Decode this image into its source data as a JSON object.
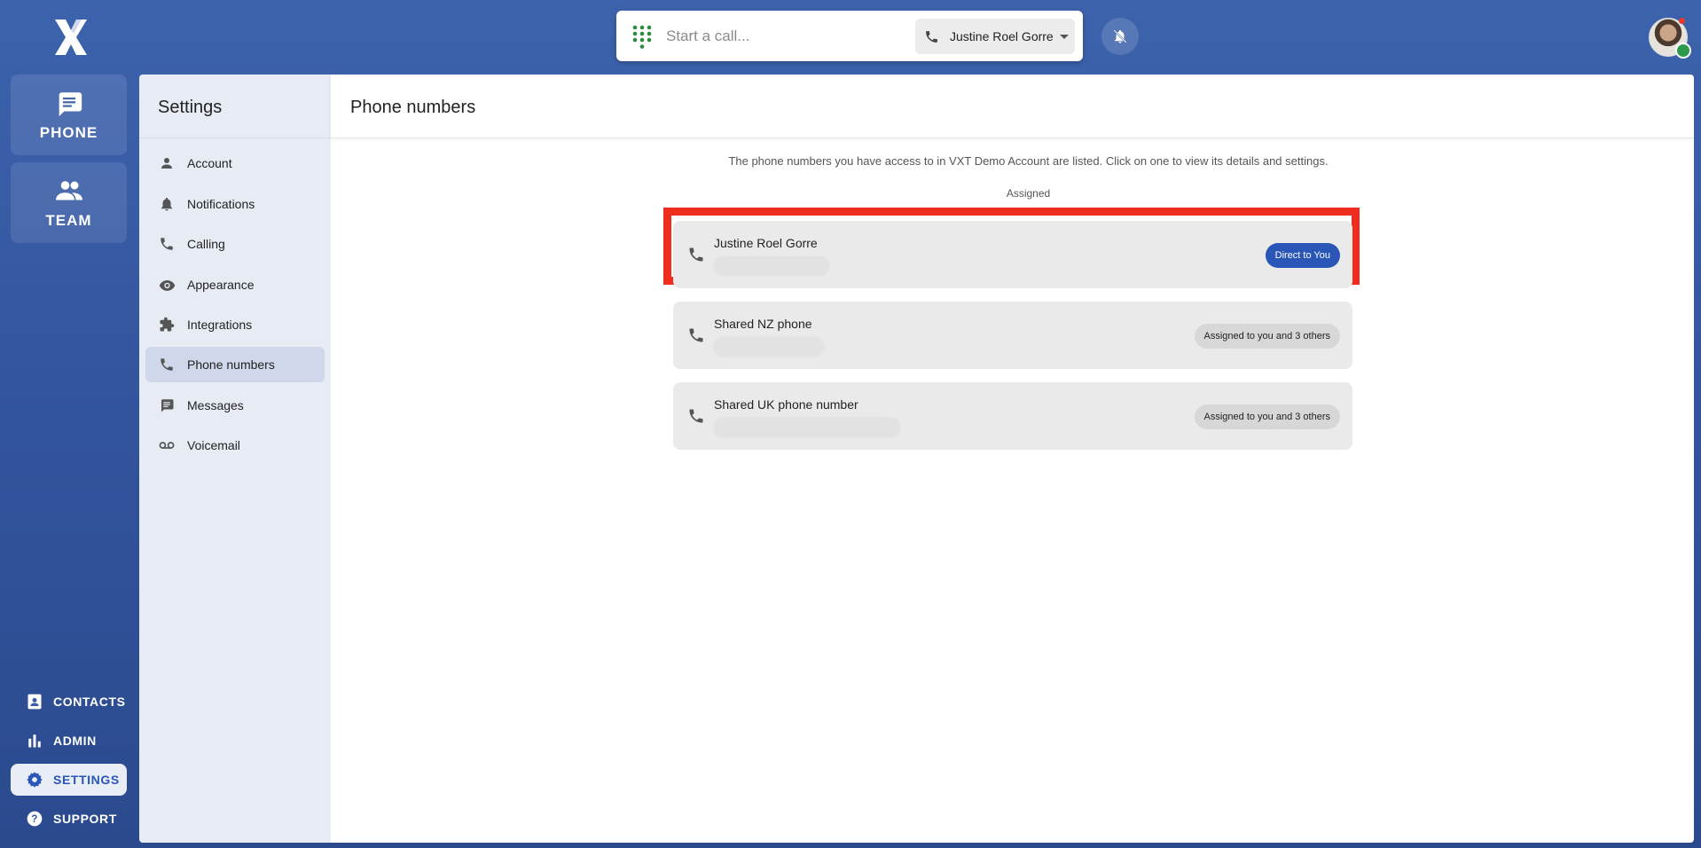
{
  "app": {
    "rail": {
      "phone_label": "PHONE",
      "team_label": "TEAM"
    },
    "bottom_nav": [
      {
        "label": "CONTACTS",
        "icon": "contacts-icon"
      },
      {
        "label": "ADMIN",
        "icon": "bar-chart-icon"
      },
      {
        "label": "SETTINGS",
        "icon": "gear-icon",
        "active": true
      },
      {
        "label": "SUPPORT",
        "icon": "help-circle-icon"
      }
    ]
  },
  "callbar": {
    "placeholder": "Start a call...",
    "caller_id": "Justine Roel Gorre"
  },
  "settings": {
    "title": "Settings",
    "items": [
      {
        "label": "Account",
        "icon": "person-icon"
      },
      {
        "label": "Notifications",
        "icon": "bell-icon"
      },
      {
        "label": "Calling",
        "icon": "phone-icon"
      },
      {
        "label": "Appearance",
        "icon": "eye-icon"
      },
      {
        "label": "Integrations",
        "icon": "puzzle-icon"
      },
      {
        "label": "Phone numbers",
        "icon": "phone-icon",
        "active": true
      },
      {
        "label": "Messages",
        "icon": "message-icon"
      },
      {
        "label": "Voicemail",
        "icon": "voicemail-icon"
      }
    ]
  },
  "main": {
    "title": "Phone numbers",
    "intro": "The phone numbers you have access to in VXT Demo Account are listed. Click on one to view its details and settings.",
    "group_label": "Assigned",
    "numbers": [
      {
        "name": "Justine Roel Gorre",
        "badge": "Direct to You"
      },
      {
        "name": "Shared NZ phone",
        "badge": "Assigned to you and 3 others"
      },
      {
        "name": "Shared UK phone number",
        "badge": "Assigned to you and 3 others"
      }
    ]
  },
  "colors": {
    "background": "#3558a3",
    "accent": "#2a56b8",
    "highlight": "#ee2d1f",
    "dialpad": "#2e8b3d"
  }
}
